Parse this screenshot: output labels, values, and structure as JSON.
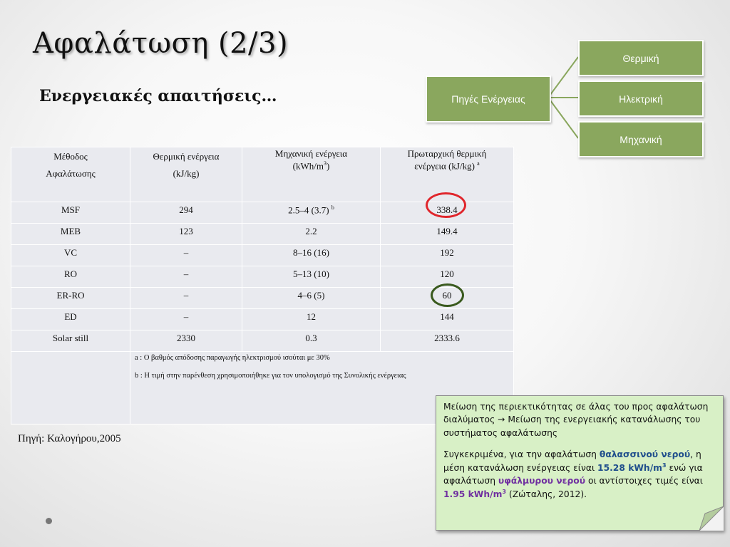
{
  "title": "Αφαλάτωση (2/3)",
  "subtitle": "Ενεργειακές απαιτήσεις…",
  "energy_tree": {
    "root": "Πηγές Ενέργειας",
    "children": [
      "Θερμική",
      "Ηλεκτρική",
      "Μηχανική"
    ],
    "color": "#8aa75e"
  },
  "table": {
    "headers": {
      "method_line1": "Μέθοδος",
      "method_line2": "Αφαλάτωσης",
      "thermal_line1": "Θερμική ενέργεια",
      "thermal_line2": "(kJ/kg)",
      "mech_line1": "Μηχανική ενέργεια",
      "mech_unit_pre": "(kWh/m",
      "mech_unit_sup": "3",
      "mech_unit_post": ")",
      "primary_line1": "Πρωταρχική θερμική",
      "primary_line2": "ενέργεια (kJ/kg)",
      "primary_sup": "a"
    },
    "rows": [
      {
        "method": "MSF",
        "thermal": "294",
        "mech": "2.5–4 (3.7)",
        "mech_sup": "b",
        "primary": "338.4"
      },
      {
        "method": "MEB",
        "thermal": "123",
        "mech": "2.2",
        "mech_sup": "",
        "primary": "149.4"
      },
      {
        "method": "VC",
        "thermal": "–",
        "mech": "8–16 (16)",
        "mech_sup": "",
        "primary": "192"
      },
      {
        "method": "RO",
        "thermal": "–",
        "mech": "5–13 (10)",
        "mech_sup": "",
        "primary": "120"
      },
      {
        "method": "ER-RO",
        "thermal": "–",
        "mech": "4–6 (5)",
        "mech_sup": "",
        "primary": "60"
      },
      {
        "method": "ED",
        "thermal": "–",
        "mech": "12",
        "mech_sup": "",
        "primary": "144"
      },
      {
        "method": "Solar still",
        "thermal": "2330",
        "mech": "0.3",
        "mech_sup": "",
        "primary": "2333.6"
      }
    ],
    "footnotes": [
      "a : Ο βαθμός απόδοσης παραγωγής ηλεκτρισμού ισούται με 30%",
      "b :  Η τιμή στην παρένθεση χρησιμοποιήθηκε για τον υπολογισμό της Συνολικής ενέργειας"
    ],
    "highlight_colors": {
      "msf_primary": "#e0262c",
      "erro_primary": "#3a5a1e"
    }
  },
  "source": "Πηγή: Καλογήρου,2005",
  "note": {
    "para1": "Μείωση της περιεκτικότητας σε άλας του προς αφαλάτωση διαλύματος → Μείωση της ενεργειακής κατανάλωσης του συστήματος αφαλάτωσης",
    "p2_a": "Συγκεκριμένα, για την αφαλάτωση ",
    "p2_sea": "θαλασσινού νερού",
    "p2_b": ", η μέση κατανάλωση ενέργειας είναι ",
    "p2_val1": "15.28 kWh/m",
    "p2_val1_sup": "3",
    "p2_c": "  ενώ για αφαλάτωση ",
    "p2_brackish": "υφάλμυρου νερού",
    "p2_d": " οι αντίστοιχες τιμές είναι ",
    "p2_val2": "1.95 kWh/m",
    "p2_val2_sup": "3",
    "p2_e": " (Ζώταλης, 2012).",
    "bg_color": "#d8f0c6"
  }
}
